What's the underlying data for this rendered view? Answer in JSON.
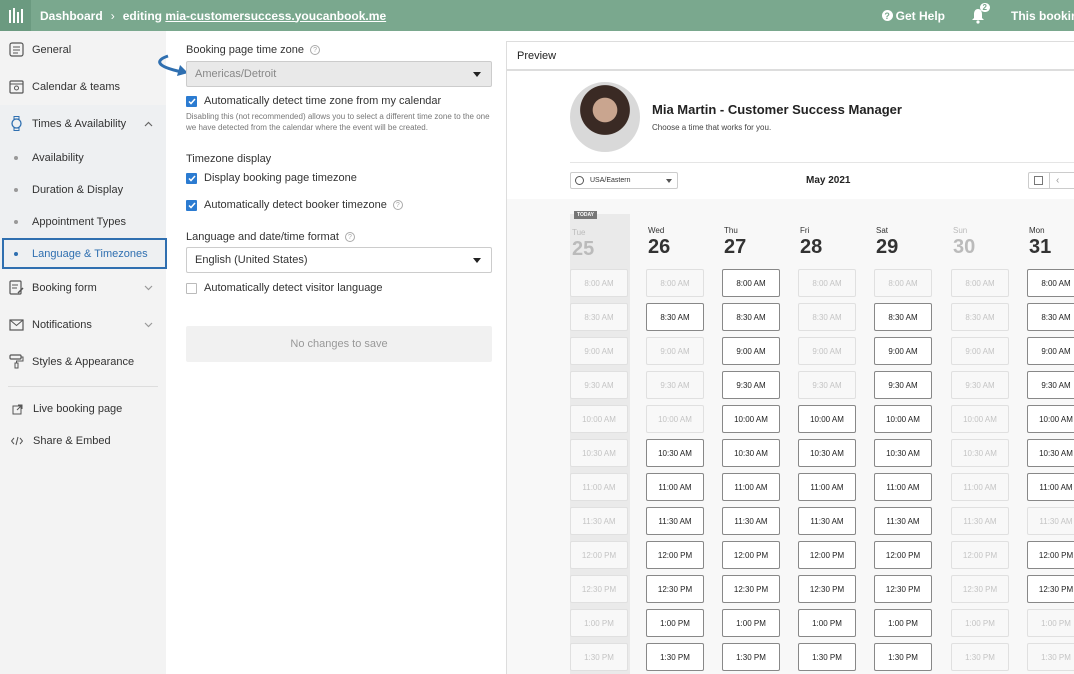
{
  "topbar": {
    "dashboard": "Dashboard",
    "editing_prefix": "editing",
    "editing_link": "mia-customersuccess.youcanbook.me",
    "help": "Get Help",
    "notif_count": "2",
    "booking": "This booking page"
  },
  "sidebar": {
    "general": "General",
    "calendar": "Calendar & teams",
    "times": "Times & Availability",
    "sub": [
      "Availability",
      "Duration & Display",
      "Appointment Types",
      "Language & Timezones"
    ],
    "booking_form": "Booking form",
    "notifications": "Notifications",
    "styles": "Styles & Appearance",
    "live": "Live booking page",
    "share": "Share & Embed"
  },
  "settings": {
    "tz_label": "Booking page time zone",
    "tz_value": "Americas/Detroit",
    "auto_detect": "Automatically detect time zone from my calendar",
    "hint": "Disabling this (not recommended) allows you to select a different time zone to the one we have detected from the calendar where the event will be created.",
    "tz_display": "Timezone display",
    "display_tz": "Display booking page timezone",
    "auto_booker": "Automatically detect booker timezone",
    "lang_label": "Language and date/time format",
    "lang_value": "English (United States)",
    "auto_visitor": "Automatically detect visitor language",
    "save": "No changes to save"
  },
  "preview": {
    "title": "Preview",
    "name": "Mia Martin - Customer Success Manager",
    "subtitle": "Choose a time that works for you.",
    "tz": "USA/Eastern",
    "month": "May 2021",
    "today_tag": "TODAY",
    "days": [
      {
        "name": "Tue",
        "num": "25"
      },
      {
        "name": "Wed",
        "num": "26"
      },
      {
        "name": "Thu",
        "num": "27"
      },
      {
        "name": "Fri",
        "num": "28"
      },
      {
        "name": "Sat",
        "num": "29"
      },
      {
        "name": "Sun",
        "num": "30"
      },
      {
        "name": "Mon",
        "num": "31"
      }
    ],
    "times": [
      "8:00 AM",
      "8:30 AM",
      "9:00 AM",
      "9:30 AM",
      "10:00 AM",
      "10:30 AM",
      "11:00 AM",
      "11:30 AM",
      "12:00 PM",
      "12:30 PM",
      "1:00 PM",
      "1:30 PM"
    ],
    "available": [
      [
        0,
        0,
        0,
        0,
        0,
        0,
        0,
        0,
        0,
        0,
        0,
        0
      ],
      [
        0,
        1,
        0,
        0,
        0,
        1,
        1,
        1,
        1,
        1,
        1,
        1
      ],
      [
        1,
        1,
        1,
        1,
        1,
        1,
        1,
        1,
        1,
        1,
        1,
        1
      ],
      [
        0,
        0,
        0,
        0,
        1,
        1,
        1,
        1,
        1,
        1,
        1,
        1
      ],
      [
        0,
        1,
        1,
        1,
        1,
        1,
        1,
        1,
        1,
        1,
        1,
        1
      ],
      [
        0,
        0,
        0,
        0,
        0,
        0,
        0,
        0,
        0,
        0,
        0,
        0
      ],
      [
        1,
        1,
        1,
        1,
        1,
        1,
        1,
        0,
        1,
        1,
        0,
        0
      ]
    ]
  },
  "colors": {
    "topbar": "#7aa88e",
    "accent": "#2f6fb0"
  }
}
